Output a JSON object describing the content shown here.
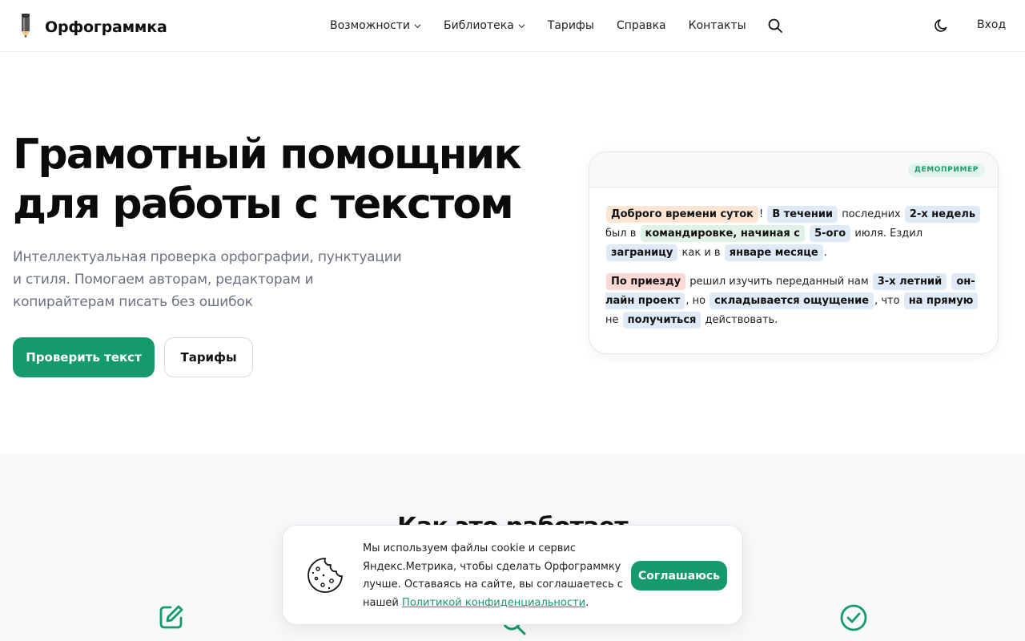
{
  "header": {
    "logo_text": "Орфограммка",
    "nav": [
      {
        "label": "Возможности",
        "has_dropdown": true
      },
      {
        "label": "Библиотека",
        "has_dropdown": true
      },
      {
        "label": "Тарифы",
        "has_dropdown": false
      },
      {
        "label": "Справка",
        "has_dropdown": false
      },
      {
        "label": "Контакты",
        "has_dropdown": false
      }
    ],
    "search_icon": "search-icon",
    "theme_icon": "moon-icon",
    "login_label": "Вход"
  },
  "hero": {
    "title_line1": "Грамотный помощник",
    "title_line2": "для работы с текстом",
    "subtitle": "Интеллектуальная проверка орфографии, пунктуации и стиля. Помогаем авторам, редакторам и копирайтерам писать без ошибок",
    "primary_button": "Проверить текст",
    "secondary_button": "Тарифы"
  },
  "demo": {
    "badge": "ДЕМОПРИМЕР",
    "para1": [
      {
        "text": "Доброго времени суток",
        "mark": "orange"
      },
      {
        "text": "!",
        "mark": null
      },
      {
        "text": "В течении",
        "mark": "blue"
      },
      {
        "text": "последних",
        "mark": null
      },
      {
        "text": "2-х недель",
        "mark": "blue"
      },
      {
        "text": "был в",
        "mark": null
      },
      {
        "text": "командировке, начиная с",
        "mark": "green"
      },
      {
        "text": "5-ого",
        "mark": "blue"
      },
      {
        "text": "июля. Ездил",
        "mark": null
      },
      {
        "text": "заграницу",
        "mark": "blue"
      },
      {
        "text": "как и в",
        "mark": null
      },
      {
        "text": "январе месяце",
        "mark": "blue"
      },
      {
        "text": ".",
        "mark": null
      }
    ],
    "para2": [
      {
        "text": "По приезду",
        "mark": "red"
      },
      {
        "text": "решил изучить переданный нам",
        "mark": null
      },
      {
        "text": "3-х летний",
        "mark": "blue"
      },
      {
        "text": "он-лайн проект",
        "mark": "blue"
      },
      {
        "text": ", но",
        "mark": null
      },
      {
        "text": "складывается ощущение",
        "mark": "blue"
      },
      {
        "text": ", что",
        "mark": null
      },
      {
        "text": "на прямую",
        "mark": "blue"
      },
      {
        "text": "не",
        "mark": null
      },
      {
        "text": "получиться",
        "mark": "blue"
      },
      {
        "text": "действовать.",
        "mark": null
      }
    ]
  },
  "how_it_works": {
    "title": "Как это работает",
    "icons": [
      "edit-icon",
      "search-icon",
      "check-circle-icon"
    ]
  },
  "cookie": {
    "icon": "cookie-icon",
    "text_before_link": "Мы используем файлы cookie и сервис Яндекс.Метрика, чтобы сделать Орфограммку лучше. Оставаясь на сайте, вы соглашаетесь с нашей ",
    "link_text": "Политикой конфиденциальности",
    "text_after_link": ".",
    "agree_button": "Соглашаюсь"
  },
  "colors": {
    "accent": "#159a6d",
    "mark_orange": "#fde5d3",
    "mark_blue": "#e0eaf7",
    "mark_green": "#dff2e4",
    "mark_red": "#fcd9d4"
  }
}
